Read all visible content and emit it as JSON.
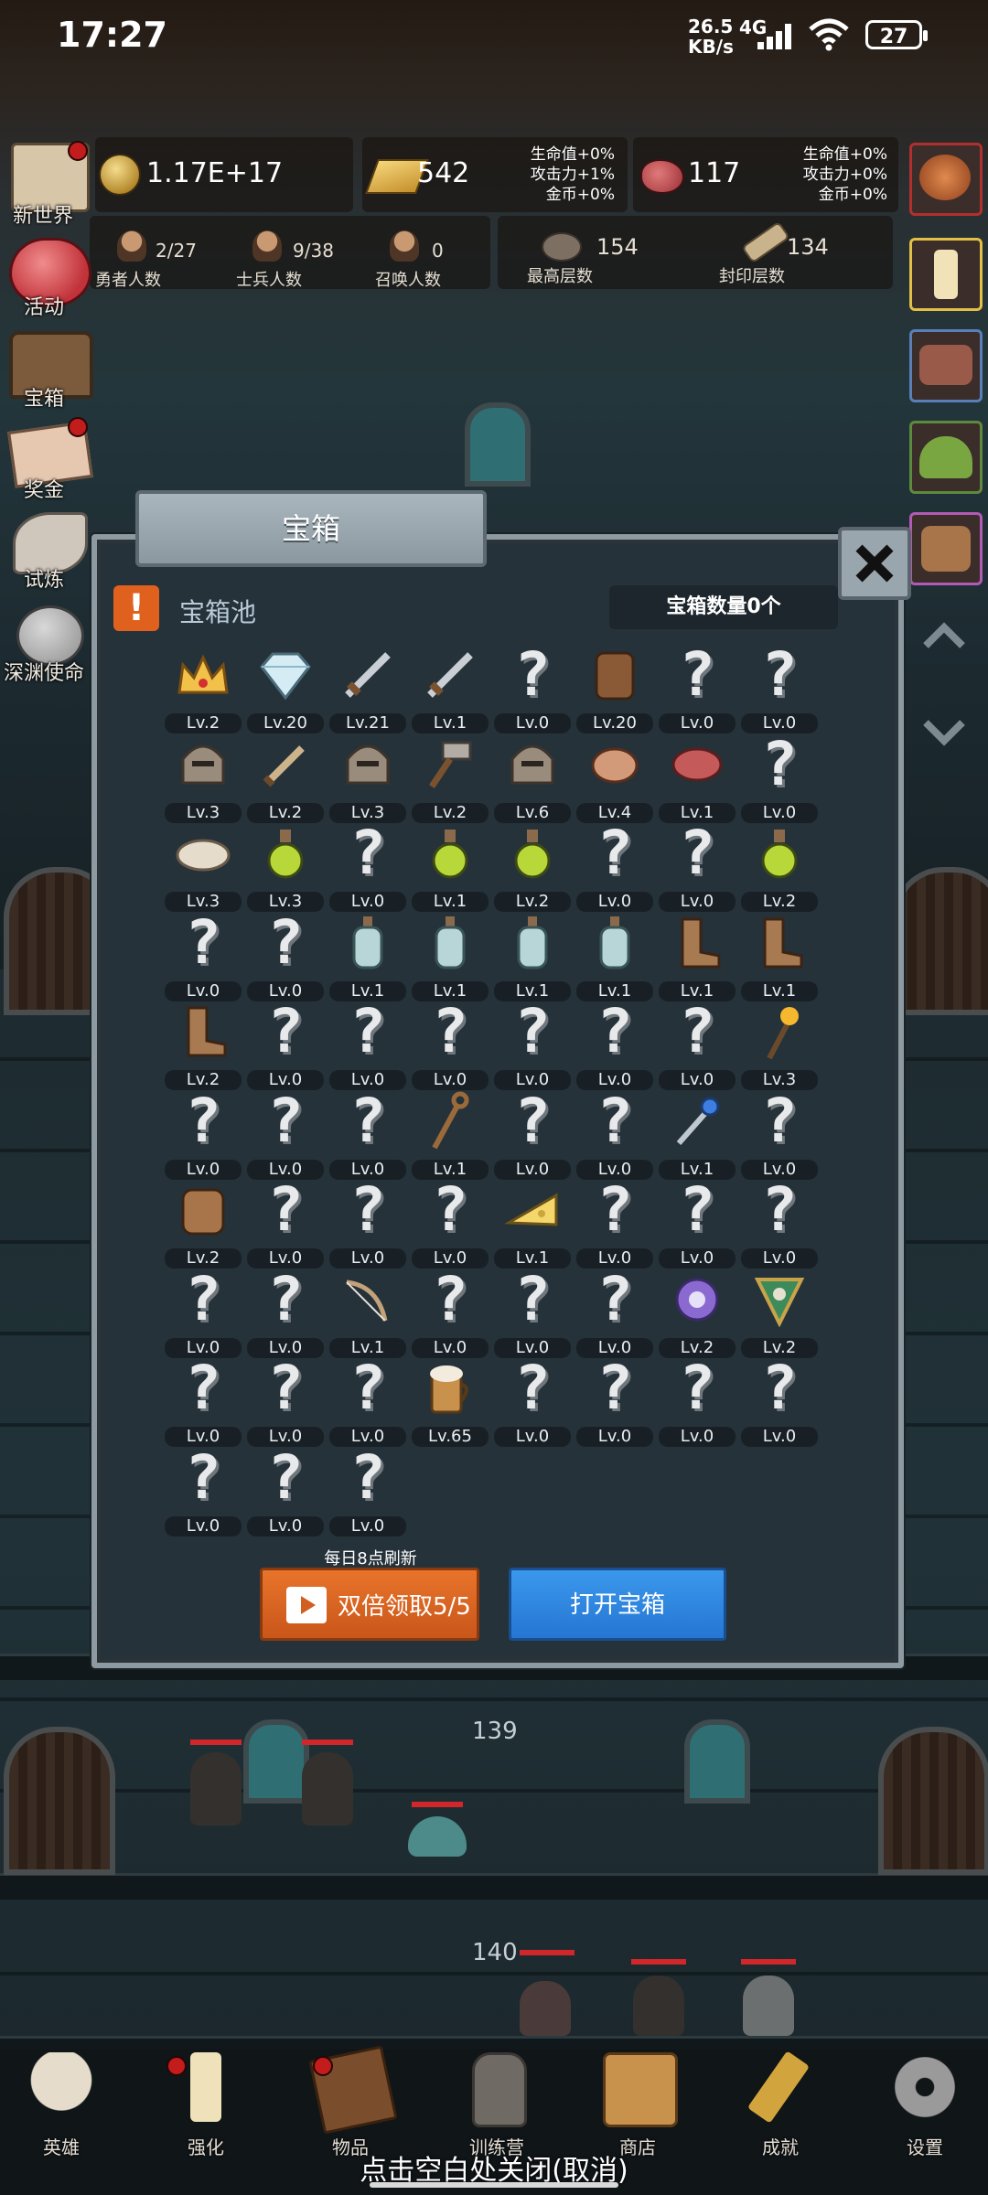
{
  "status_bar": {
    "time": "17:27",
    "net_speed_top": "26.5",
    "net_speed_unit": "KB/s",
    "network": "4G",
    "battery": "27"
  },
  "resources": {
    "coins": "1.17E+17",
    "gold": "542",
    "gold_stats": [
      "生命值+0%",
      "攻击力+1%",
      "金币+0%"
    ],
    "meat": "117",
    "meat_stats": [
      "生命值+0%",
      "攻击力+0%",
      "金币+0%"
    ]
  },
  "stats": {
    "heroes": {
      "value": "2/27",
      "label": "勇者人数"
    },
    "soldiers": {
      "value": "9/38",
      "label": "士兵人数"
    },
    "summons": {
      "value": "0",
      "label": "召唤人数"
    },
    "max_floor": {
      "value": "154",
      "label": "最高层数"
    },
    "seal_floor": {
      "value": "134",
      "label": "封印层数"
    }
  },
  "side_menu": [
    "新世界",
    "活动",
    "宝箱",
    "奖金",
    "试炼",
    "深渊使命"
  ],
  "dialog": {
    "title": "宝箱",
    "pool_title": "宝箱池",
    "chest_count": "宝箱数量0个",
    "refresh_note": "每日8点刷新",
    "double_button": "双倍领取5/5",
    "open_button": "打开宝箱"
  },
  "items": [
    {
      "icon": "crown",
      "lv": "Lv.2"
    },
    {
      "icon": "diamond",
      "lv": "Lv.20"
    },
    {
      "icon": "sword",
      "lv": "Lv.21"
    },
    {
      "icon": "sword",
      "lv": "Lv.1"
    },
    {
      "icon": "unknown",
      "lv": "Lv.0"
    },
    {
      "icon": "armor",
      "lv": "Lv.20"
    },
    {
      "icon": "unknown",
      "lv": "Lv.0"
    },
    {
      "icon": "unknown",
      "lv": "Lv.0"
    },
    {
      "icon": "helmet",
      "lv": "Lv.3"
    },
    {
      "icon": "dagger",
      "lv": "Lv.2"
    },
    {
      "icon": "helmet",
      "lv": "Lv.3"
    },
    {
      "icon": "hammer",
      "lv": "Lv.2"
    },
    {
      "icon": "helmet",
      "lv": "Lv.6"
    },
    {
      "icon": "meat",
      "lv": "Lv.4"
    },
    {
      "icon": "steak",
      "lv": "Lv.1"
    },
    {
      "icon": "unknown",
      "lv": "Lv.0"
    },
    {
      "icon": "bread",
      "lv": "Lv.3"
    },
    {
      "icon": "potion",
      "lv": "Lv.3"
    },
    {
      "icon": "unknown",
      "lv": "Lv.0"
    },
    {
      "icon": "potion",
      "lv": "Lv.1"
    },
    {
      "icon": "potion",
      "lv": "Lv.2"
    },
    {
      "icon": "unknown",
      "lv": "Lv.0"
    },
    {
      "icon": "unknown",
      "lv": "Lv.0"
    },
    {
      "icon": "potion",
      "lv": "Lv.2"
    },
    {
      "icon": "unknown",
      "lv": "Lv.0"
    },
    {
      "icon": "unknown",
      "lv": "Lv.0"
    },
    {
      "icon": "bottle",
      "lv": "Lv.1"
    },
    {
      "icon": "bottle",
      "lv": "Lv.1"
    },
    {
      "icon": "bottle",
      "lv": "Lv.1"
    },
    {
      "icon": "bottle",
      "lv": "Lv.1"
    },
    {
      "icon": "boot",
      "lv": "Lv.1"
    },
    {
      "icon": "boot",
      "lv": "Lv.1"
    },
    {
      "icon": "boot",
      "lv": "Lv.2"
    },
    {
      "icon": "unknown",
      "lv": "Lv.0"
    },
    {
      "icon": "unknown",
      "lv": "Lv.0"
    },
    {
      "icon": "unknown",
      "lv": "Lv.0"
    },
    {
      "icon": "unknown",
      "lv": "Lv.0"
    },
    {
      "icon": "unknown",
      "lv": "Lv.0"
    },
    {
      "icon": "unknown",
      "lv": "Lv.0"
    },
    {
      "icon": "torch",
      "lv": "Lv.3"
    },
    {
      "icon": "unknown",
      "lv": "Lv.0"
    },
    {
      "icon": "unknown",
      "lv": "Lv.0"
    },
    {
      "icon": "unknown",
      "lv": "Lv.0"
    },
    {
      "icon": "staff",
      "lv": "Lv.1"
    },
    {
      "icon": "unknown",
      "lv": "Lv.0"
    },
    {
      "icon": "unknown",
      "lv": "Lv.0"
    },
    {
      "icon": "wand",
      "lv": "Lv.1"
    },
    {
      "icon": "unknown",
      "lv": "Lv.0"
    },
    {
      "icon": "backpack",
      "lv": "Lv.2"
    },
    {
      "icon": "unknown",
      "lv": "Lv.0"
    },
    {
      "icon": "unknown",
      "lv": "Lv.0"
    },
    {
      "icon": "unknown",
      "lv": "Lv.0"
    },
    {
      "icon": "cheese",
      "lv": "Lv.1"
    },
    {
      "icon": "unknown",
      "lv": "Lv.0"
    },
    {
      "icon": "unknown",
      "lv": "Lv.0"
    },
    {
      "icon": "unknown",
      "lv": "Lv.0"
    },
    {
      "icon": "unknown",
      "lv": "Lv.0"
    },
    {
      "icon": "unknown",
      "lv": "Lv.0"
    },
    {
      "icon": "bow",
      "lv": "Lv.1"
    },
    {
      "icon": "unknown",
      "lv": "Lv.0"
    },
    {
      "icon": "unknown",
      "lv": "Lv.0"
    },
    {
      "icon": "unknown",
      "lv": "Lv.0"
    },
    {
      "icon": "gem-ring",
      "lv": "Lv.2"
    },
    {
      "icon": "shield",
      "lv": "Lv.2"
    },
    {
      "icon": "unknown",
      "lv": "Lv.0"
    },
    {
      "icon": "unknown",
      "lv": "Lv.0"
    },
    {
      "icon": "unknown",
      "lv": "Lv.0"
    },
    {
      "icon": "beer",
      "lv": "Lv.65"
    },
    {
      "icon": "unknown",
      "lv": "Lv.0"
    },
    {
      "icon": "unknown",
      "lv": "Lv.0"
    },
    {
      "icon": "unknown",
      "lv": "Lv.0"
    },
    {
      "icon": "unknown",
      "lv": "Lv.0"
    },
    {
      "icon": "unknown",
      "lv": "Lv.0"
    },
    {
      "icon": "unknown",
      "lv": "Lv.0"
    },
    {
      "icon": "unknown",
      "lv": "Lv.0"
    }
  ],
  "floors": [
    "139",
    "140"
  ],
  "bottom_nav": [
    "英雄",
    "强化",
    "物品",
    "训练营",
    "商店",
    "成就",
    "设置"
  ],
  "close_hint": "点击空白处关闭(取消)",
  "colors": {
    "accent_orange": "#e0611e",
    "accent_blue": "#2e86e0",
    "dialog_bg": "#25323a"
  }
}
